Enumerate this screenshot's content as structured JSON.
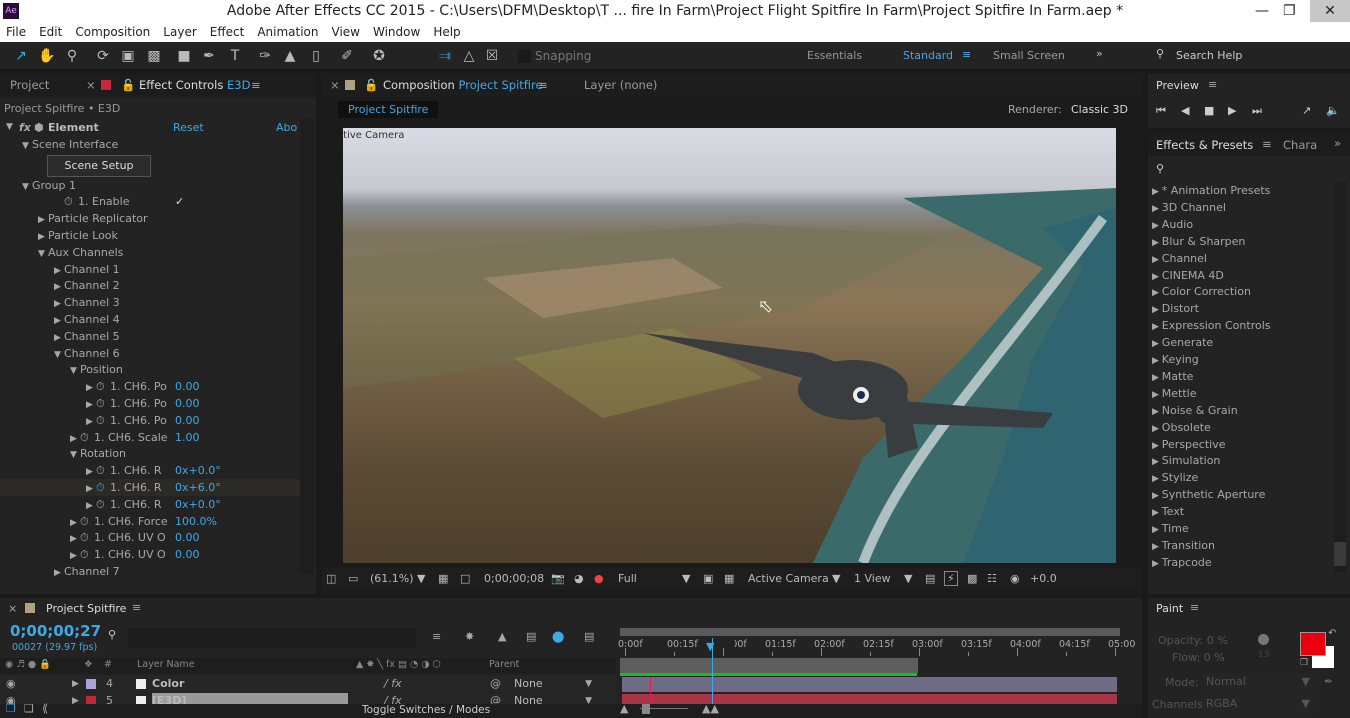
{
  "window": {
    "title": "Adobe After Effects CC 2015 - C:\\Users\\DFM\\Desktop\\T ... fire In Farm\\Project Flight Spitfire In Farm\\Project Spitfire In Farm.aep *",
    "app_icon": "Ae"
  },
  "menu": [
    "File",
    "Edit",
    "Composition",
    "Layer",
    "Effect",
    "Animation",
    "View",
    "Window",
    "Help"
  ],
  "toolbar": {
    "snapping": "Snapping",
    "workspaces": [
      "Essentials",
      "Standard",
      "Small Screen"
    ],
    "active_workspace": "Standard",
    "search_help": "Search Help"
  },
  "left_panel": {
    "tab_project": "Project",
    "tab_effect_controls": "Effect Controls",
    "tab_effect_layer": "E3D",
    "breadcrumb": "Project Spitfire • E3D",
    "effect_name": "Element",
    "reset": "Reset",
    "about": "Abo",
    "scene_setup": "Scene Setup",
    "rows": [
      {
        "label": "Scene Interface",
        "indent": 1,
        "arrow": "down"
      },
      {
        "label": "",
        "indent": 0,
        "arrow": "",
        "button": true
      },
      {
        "label": "Group 1",
        "indent": 1,
        "arrow": "down"
      },
      {
        "label": "1. Enable",
        "indent": 3,
        "arrow": "",
        "sw": true,
        "check": "✓"
      },
      {
        "label": "Particle Replicator",
        "indent": 2,
        "arrow": "right"
      },
      {
        "label": "Particle Look",
        "indent": 2,
        "arrow": "right"
      },
      {
        "label": "Aux Channels",
        "indent": 2,
        "arrow": "down"
      },
      {
        "label": "Channel 1",
        "indent": 3,
        "arrow": "right"
      },
      {
        "label": "Channel 2",
        "indent": 3,
        "arrow": "right"
      },
      {
        "label": "Channel 3",
        "indent": 3,
        "arrow": "right"
      },
      {
        "label": "Channel 4",
        "indent": 3,
        "arrow": "right"
      },
      {
        "label": "Channel 5",
        "indent": 3,
        "arrow": "right"
      },
      {
        "label": "Channel 6",
        "indent": 3,
        "arrow": "down"
      },
      {
        "label": "Position",
        "indent": 4,
        "arrow": "down"
      },
      {
        "label": "1. CH6. Po",
        "indent": 5,
        "arrow": "right",
        "sw": true,
        "value": "0.00"
      },
      {
        "label": "1. CH6. Po",
        "indent": 5,
        "arrow": "right",
        "sw": true,
        "value": "0.00"
      },
      {
        "label": "1. CH6. Po",
        "indent": 5,
        "arrow": "right",
        "sw": true,
        "value": "0.00"
      },
      {
        "label": "1. CH6. Scale",
        "indent": 4,
        "arrow": "right",
        "sw": true,
        "value": "1.00"
      },
      {
        "label": "Rotation",
        "indent": 4,
        "arrow": "down"
      },
      {
        "label": "1. CH6. R",
        "indent": 5,
        "arrow": "right",
        "sw": true,
        "value": "0x+0.0°"
      },
      {
        "label": "1. CH6. R",
        "indent": 5,
        "arrow": "right",
        "sw": true,
        "value": "0x+6.0°",
        "active": true
      },
      {
        "label": "1. CH6. R",
        "indent": 5,
        "arrow": "right",
        "sw": true,
        "value": "0x+0.0°"
      },
      {
        "label": "1. CH6. Force",
        "indent": 4,
        "arrow": "right",
        "sw": true,
        "value": "100.0%"
      },
      {
        "label": "1. CH6. UV O",
        "indent": 4,
        "arrow": "right",
        "sw": true,
        "value": "0.00"
      },
      {
        "label": "1. CH6. UV O",
        "indent": 4,
        "arrow": "right",
        "sw": true,
        "value": "0.00"
      },
      {
        "label": "Channel 7",
        "indent": 3,
        "arrow": "right"
      }
    ]
  },
  "composition": {
    "tab_label": "Composition",
    "comp_name": "Project Spitfire",
    "layer_tab": "Layer (none)",
    "comp_button": "Project Spitfire",
    "renderer_label": "Renderer:",
    "renderer": "Classic 3D",
    "view_label": "Active Camera",
    "footer": {
      "zoom": "(61.1%)",
      "timecode": "0;00;00;08",
      "resolution": "Full",
      "camera": "Active Camera",
      "views": "1 View",
      "exposure": "+0.0"
    }
  },
  "preview": {
    "title": "Preview"
  },
  "effects_presets": {
    "tab": "Effects & Presets",
    "tab2": "Chara",
    "search_placeholder": "",
    "items": [
      "* Animation Presets",
      "3D Channel",
      "Audio",
      "Blur & Sharpen",
      "Channel",
      "CINEMA 4D",
      "Color Correction",
      "Distort",
      "Expression Controls",
      "Generate",
      "Keying",
      "Matte",
      "Mettle",
      "Noise & Grain",
      "Obsolete",
      "Perspective",
      "Simulation",
      "Stylize",
      "Synthetic Aperture",
      "Text",
      "Time",
      "Transition",
      "Trapcode"
    ]
  },
  "timeline": {
    "tab": "Project Spitfire",
    "timecode": "0;00;00;27",
    "frames": "00027 (29.97 fps)",
    "columns": {
      "layer_name": "Layer Name",
      "number": "#",
      "parent": "Parent"
    },
    "layers": [
      {
        "num": "4",
        "name": "Color",
        "parent": "None",
        "label_color": "#a9a3d6"
      },
      {
        "num": "5",
        "name": "[E3D]",
        "parent": "None",
        "label_color": "#c0283a"
      }
    ],
    "ruler": [
      "0:00f",
      "00:15f",
      "01:00f",
      "01:15f",
      "02:00f",
      "02:15f",
      "03:00f",
      "03:15f",
      "04:00f",
      "04:15f",
      "05:00"
    ],
    "toggle": "Toggle Switches / Modes"
  },
  "paint": {
    "title": "Paint",
    "opacity": "Opacity: 0 %",
    "flow": "Flow: 0 %",
    "mode_label": "Mode:",
    "mode": "Normal",
    "channels_label": "Channels:",
    "channels": "RGBA",
    "brush_size": "13",
    "foreground": "#e8000f",
    "background": "#ffffff"
  },
  "colors": {
    "accent": "#3fa9e6",
    "panel": "#232323"
  }
}
